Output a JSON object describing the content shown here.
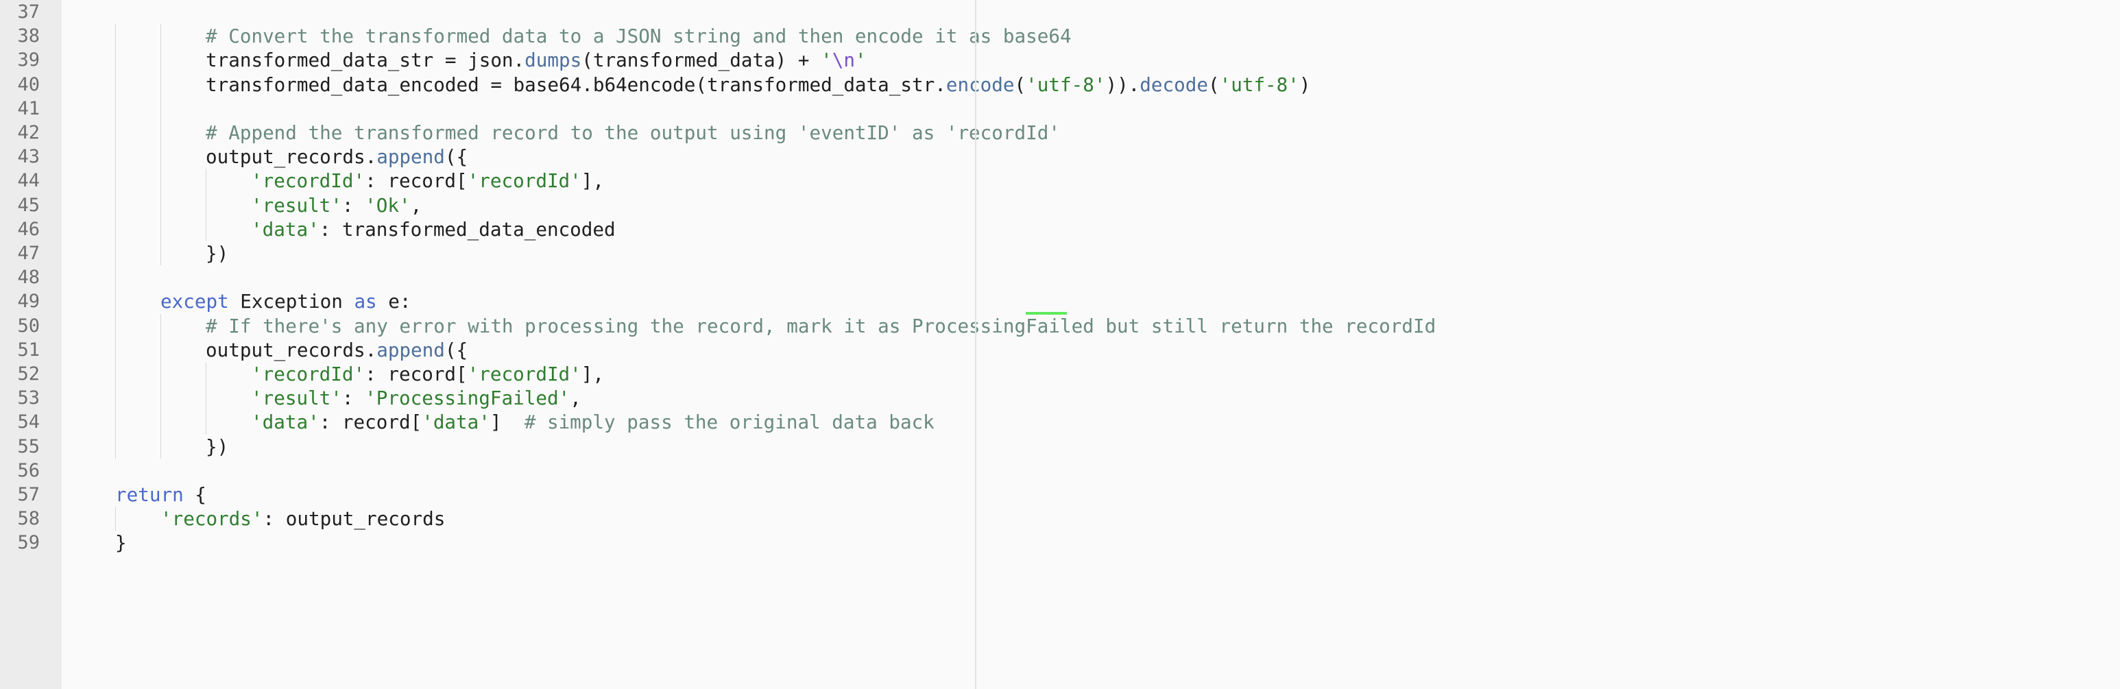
{
  "editor": {
    "line_numbers": [
      "37",
      "38",
      "39",
      "40",
      "41",
      "42",
      "43",
      "44",
      "45",
      "46",
      "47",
      "48",
      "49",
      "50",
      "51",
      "52",
      "53",
      "54",
      "55",
      "56",
      "57",
      "58",
      "59"
    ],
    "lines": [
      [],
      [
        {
          "t": "comment",
          "v": "# Convert the transformed data to a JSON string and then encode it as base64"
        }
      ],
      [
        {
          "t": "plain",
          "v": "transformed_data_str = json."
        },
        {
          "t": "func",
          "v": "dumps"
        },
        {
          "t": "plain",
          "v": "(transformed_data) + "
        },
        {
          "t": "string",
          "v": "'"
        },
        {
          "t": "escape",
          "v": "\\n"
        },
        {
          "t": "string",
          "v": "'"
        }
      ],
      [
        {
          "t": "plain",
          "v": "transformed_data_encoded = base64.b64encode(transformed_data_str."
        },
        {
          "t": "func",
          "v": "encode"
        },
        {
          "t": "plain",
          "v": "("
        },
        {
          "t": "string",
          "v": "'utf-8'"
        },
        {
          "t": "plain",
          "v": "))."
        },
        {
          "t": "func",
          "v": "decode"
        },
        {
          "t": "plain",
          "v": "("
        },
        {
          "t": "string",
          "v": "'utf-8'"
        },
        {
          "t": "plain",
          "v": ")"
        }
      ],
      [],
      [
        {
          "t": "comment",
          "v": "# Append the transformed record to the output using 'eventID' as 'recordId'"
        }
      ],
      [
        {
          "t": "plain",
          "v": "output_records."
        },
        {
          "t": "func",
          "v": "append"
        },
        {
          "t": "plain",
          "v": "({"
        }
      ],
      [
        {
          "t": "string",
          "v": "'recordId'"
        },
        {
          "t": "plain",
          "v": ": record["
        },
        {
          "t": "string",
          "v": "'recordId'"
        },
        {
          "t": "plain",
          "v": "],"
        }
      ],
      [
        {
          "t": "string",
          "v": "'result'"
        },
        {
          "t": "plain",
          "v": ": "
        },
        {
          "t": "string",
          "v": "'Ok'"
        },
        {
          "t": "plain",
          "v": ","
        }
      ],
      [
        {
          "t": "string",
          "v": "'data'"
        },
        {
          "t": "plain",
          "v": ": transformed_data_encoded"
        }
      ],
      [
        {
          "t": "plain",
          "v": "})"
        }
      ],
      [],
      [
        {
          "t": "keyword",
          "v": "except"
        },
        {
          "t": "plain",
          "v": " Exception "
        },
        {
          "t": "keyword",
          "v": "as"
        },
        {
          "t": "plain",
          "v": " e:"
        }
      ],
      [
        {
          "t": "comment",
          "v": "# If there's any error with processing the record, mark it as ProcessingFailed but still return the recordId"
        }
      ],
      [
        {
          "t": "plain",
          "v": "output_records."
        },
        {
          "t": "func",
          "v": "append"
        },
        {
          "t": "plain",
          "v": "({"
        }
      ],
      [
        {
          "t": "string",
          "v": "'recordId'"
        },
        {
          "t": "plain",
          "v": ": record["
        },
        {
          "t": "string",
          "v": "'recordId'"
        },
        {
          "t": "plain",
          "v": "],"
        }
      ],
      [
        {
          "t": "string",
          "v": "'result'"
        },
        {
          "t": "plain",
          "v": ": "
        },
        {
          "t": "string",
          "v": "'ProcessingFailed'"
        },
        {
          "t": "plain",
          "v": ","
        }
      ],
      [
        {
          "t": "string",
          "v": "'data'"
        },
        {
          "t": "plain",
          "v": ": record["
        },
        {
          "t": "string",
          "v": "'data'"
        },
        {
          "t": "plain",
          "v": "]  "
        },
        {
          "t": "comment",
          "v": "# simply pass the original data back"
        }
      ],
      [
        {
          "t": "plain",
          "v": "})"
        }
      ],
      [],
      [
        {
          "t": "keyword",
          "v": "return"
        },
        {
          "t": "plain",
          "v": " {"
        }
      ],
      [
        {
          "t": "string",
          "v": "'records'"
        },
        {
          "t": "plain",
          "v": ": output_records"
        }
      ],
      [
        {
          "t": "plain",
          "v": "}"
        }
      ]
    ],
    "indent_levels": [
      0,
      2,
      2,
      2,
      0,
      2,
      2,
      3,
      3,
      3,
      2,
      0,
      1,
      2,
      2,
      3,
      3,
      3,
      2,
      0,
      0,
      1,
      0
    ]
  }
}
